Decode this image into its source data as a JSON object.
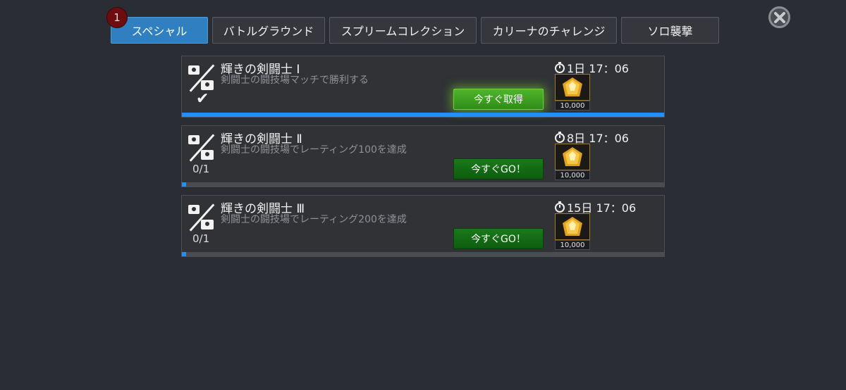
{
  "tabs": [
    {
      "label": "スペシャル",
      "active": true,
      "badge": "1"
    },
    {
      "label": "バトルグラウンド",
      "active": false
    },
    {
      "label": "スプリームコレクション",
      "active": false
    },
    {
      "label": "カリーナのチャレンジ",
      "active": false
    },
    {
      "label": "ソロ襲撃",
      "active": false
    }
  ],
  "close_icon": "close-x-icon",
  "quests": [
    {
      "title": "輝きの剣闘士 Ⅰ",
      "description": "剣闘士の闘技場マッチで勝利する",
      "completed": true,
      "button": "今すぐ取得",
      "timer": "1日 17：06",
      "reward_qty": "10,000",
      "progress_fraction": 1.0
    },
    {
      "title": "輝きの剣闘士 Ⅱ",
      "description": "剣闘士の闘技場でレーティング100を達成",
      "completed": false,
      "progress": "0/1",
      "button": "今すぐGO！",
      "timer": "8日 17：06",
      "reward_qty": "10,000",
      "progress_fraction": 0.0
    },
    {
      "title": "輝きの剣闘士 Ⅲ",
      "description": "剣闘士の闘技場でレーティング200を達成",
      "completed": false,
      "progress": "0/1",
      "button": "今すぐGO！",
      "timer": "15日 17：06",
      "reward_qty": "10,000",
      "progress_fraction": 0.0
    }
  ],
  "colors": {
    "accent_blue": "#2f7fc1",
    "claim_green": "#4fb52c",
    "go_green": "#0e5c0e",
    "badge_red": "#6e0c10"
  }
}
